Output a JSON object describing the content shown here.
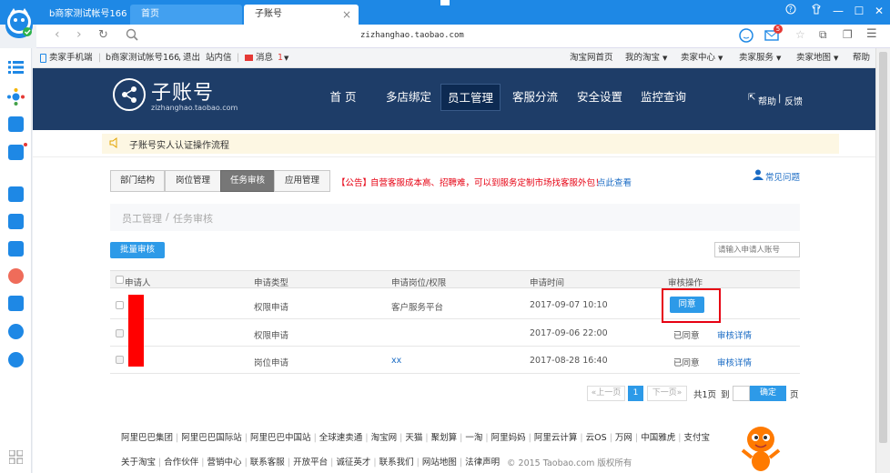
{
  "browser": {
    "tabs": [
      {
        "label": "b商家测试帐号166"
      },
      {
        "label": "首页"
      },
      {
        "label": "子账号"
      }
    ],
    "url": "zizhanghao.taobao.com",
    "mail_badge": "5",
    "colors": {
      "chrome": "#1e88e5",
      "header": "#1e3d68",
      "accent_red": "#e60012",
      "link": "#1a6bc4"
    }
  },
  "sitebar": {
    "seller_phone": "卖家手机端",
    "account_text": "b商家测试帐号166",
    "logout": "退出",
    "inbox": "站内信",
    "msg_label": "消息",
    "msg_count": "1",
    "links": [
      "淘宝网首页",
      "我的淘宝",
      "卖家中心",
      "卖家服务",
      "卖家地图",
      "帮助"
    ]
  },
  "header": {
    "logo_title": "子账号",
    "logo_sub": "zizhanghao.taobao.com",
    "nav": [
      "首 页",
      "多店绑定",
      "员工管理",
      "客服分流",
      "安全设置",
      "监控查询"
    ],
    "help": "帮助",
    "feedback": "反馈"
  },
  "notice": {
    "text": "子账号实人认证操作流程"
  },
  "subtabs": [
    "部门结构",
    "岗位管理",
    "任务审核",
    "应用管理"
  ],
  "announcement": {
    "tag": "【公告】",
    "text": "自营客服成本高、招聘难，可以到服务定制市场找客服外包！",
    "link": "点此查看"
  },
  "faq": "常见问题",
  "breadcrumb": {
    "parent": "员工管理",
    "sep": "/",
    "current": "任务审核"
  },
  "batch_button": "批量审核",
  "search_placeholder": "请输入申请人账号",
  "table": {
    "headers": [
      "申请人",
      "申请类型",
      "申请岗位/权限",
      "申请时间",
      "审核操作"
    ],
    "rows": [
      {
        "type": "权限申请",
        "target": "客户服务平台",
        "time": "2017-09-07 10:10",
        "action": "同意",
        "detail": ""
      },
      {
        "type": "权限申请",
        "target": "",
        "time": "2017-09-06 22:00",
        "action": "已同意",
        "detail": "审核详情"
      },
      {
        "type": "岗位申请",
        "target": "xx",
        "time": "2017-08-28 16:40",
        "action": "已同意",
        "detail": "审核详情"
      }
    ]
  },
  "pagination": {
    "prev": "«上一页",
    "current": "1",
    "next": "下一页»",
    "total": "共1页",
    "goto_label": "到",
    "confirm": "确定",
    "unit": "页"
  },
  "footer": {
    "row1": [
      "阿里巴巴集团",
      "阿里巴巴国际站",
      "阿里巴巴中国站",
      "全球速卖通",
      "淘宝网",
      "天猫",
      "聚划算",
      "一淘",
      "阿里妈妈",
      "阿里云计算",
      "云OS",
      "万网",
      "中国雅虎",
      "支付宝"
    ],
    "row2": [
      "关于淘宝",
      "合作伙伴",
      "营销中心",
      "联系客服",
      "开放平台",
      "诚征英才",
      "联系我们",
      "网站地图",
      "法律声明"
    ],
    "copyright": "© 2015 Taobao.com 版权所有"
  }
}
